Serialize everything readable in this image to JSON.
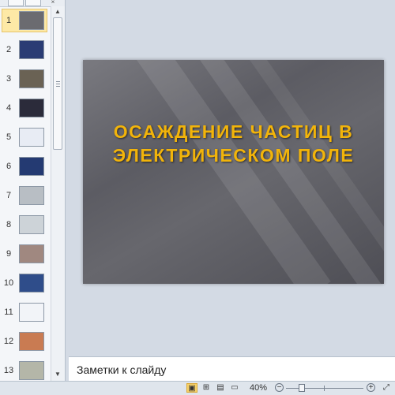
{
  "thumbnails": [
    {
      "number": "1",
      "selected": true,
      "color": "#6b6b70"
    },
    {
      "number": "2",
      "selected": false,
      "color": "#2a3c74"
    },
    {
      "number": "3",
      "selected": false,
      "color": "#6a6254"
    },
    {
      "number": "4",
      "selected": false,
      "color": "#2b2b3a"
    },
    {
      "number": "5",
      "selected": false,
      "color": "#e8ecf4"
    },
    {
      "number": "6",
      "selected": false,
      "color": "#243a72"
    },
    {
      "number": "7",
      "selected": false,
      "color": "#b8bec4"
    },
    {
      "number": "8",
      "selected": false,
      "color": "#cdd3d8"
    },
    {
      "number": "9",
      "selected": false,
      "color": "#a08880"
    },
    {
      "number": "10",
      "selected": false,
      "color": "#2f4d8a"
    },
    {
      "number": "11",
      "selected": false,
      "color": "#f2f4f8"
    },
    {
      "number": "12",
      "selected": false,
      "color": "#c97b52"
    },
    {
      "number": "13",
      "selected": false,
      "color": "#b4b6a8"
    }
  ],
  "slide": {
    "title_line1": "ОСАЖДЕНИЕ  ЧАСТИЦ В",
    "title_line2": "ЭЛЕКТРИЧЕСКОМ ПОЛЕ"
  },
  "notes": {
    "placeholder": "Заметки к слайду"
  },
  "status_bar": {
    "zoom_level": "40%",
    "zoom_out_label": "−",
    "zoom_in_label": "+"
  },
  "icons": {
    "normal_view": "normal-view-icon",
    "slide_sorter": "slide-sorter-icon",
    "reading_view": "reading-view-icon",
    "slideshow": "slideshow-icon",
    "fit_slide": "fit-to-window-icon"
  },
  "colors": {
    "title": "#f2b40a",
    "selected_thumb": "#fde9a6"
  }
}
